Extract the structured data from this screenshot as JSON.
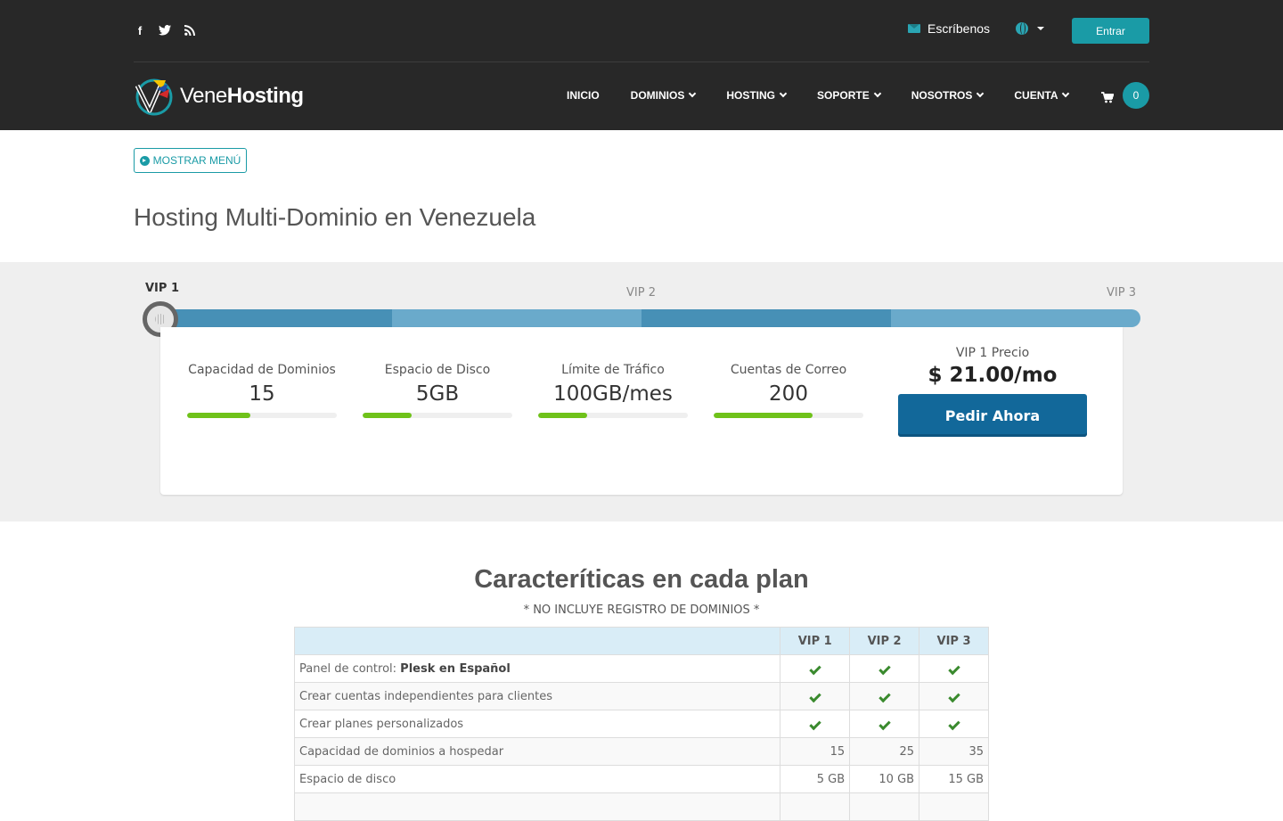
{
  "header": {
    "social": [
      {
        "icon": "facebook-icon",
        "glyph": "f"
      },
      {
        "icon": "twitter-icon",
        "glyph": "t"
      },
      {
        "icon": "rss-icon",
        "glyph": "r"
      }
    ],
    "contact_label": "Escríbenos",
    "login_label": "Entrar",
    "brand_light": "Vene",
    "brand_bold": "Hosting",
    "nav": [
      {
        "label": "INICIO",
        "dropdown": false
      },
      {
        "label": "DOMINIOS",
        "dropdown": true
      },
      {
        "label": "HOSTING",
        "dropdown": true
      },
      {
        "label": "SOPORTE",
        "dropdown": true
      },
      {
        "label": "NOSOTROS",
        "dropdown": true
      },
      {
        "label": "CUENTA",
        "dropdown": true
      }
    ],
    "cart_count": "0"
  },
  "page": {
    "menu_button": "MOSTRAR MENÚ",
    "title": "Hosting Multi-Dominio en Venezuela"
  },
  "plan_slider": {
    "tiers": [
      "VIP 1",
      "VIP 2",
      "VIP 3"
    ],
    "selected": "VIP 1",
    "colors": {
      "dark": "#4790b6",
      "light": "#6aaacb"
    }
  },
  "plan_card": {
    "stats": [
      {
        "label": "Capacidad de Dominios",
        "value": "15",
        "fill": 0.42
      },
      {
        "label": "Espacio de Disco",
        "value": "5GB",
        "fill": 0.33
      },
      {
        "label": "Límite de Tráfico",
        "value": "100GB/mes",
        "fill": 0.33
      },
      {
        "label": "Cuentas de Correo",
        "value": "200",
        "fill": 0.66
      }
    ],
    "price_label": "VIP 1 Precio",
    "price_value": "$ 21.00/mo",
    "order_button": "Pedir Ahora"
  },
  "features": {
    "title": "Caracteríticas en cada plan",
    "note": "* NO INCLUYE REGISTRO DE DOMINIOS *",
    "columns": [
      "",
      "VIP 1",
      "VIP 2",
      "VIP 3"
    ],
    "rows": [
      {
        "label": "Panel de control: ",
        "strong": "Plesk en Español",
        "type": "check",
        "values": [
          "✓",
          "✓",
          "✓"
        ]
      },
      {
        "label": "Crear cuentas independientes para clientes",
        "strong": "",
        "type": "check",
        "values": [
          "✓",
          "✓",
          "✓"
        ]
      },
      {
        "label": "Crear planes personalizados",
        "strong": "",
        "type": "check",
        "values": [
          "✓",
          "✓",
          "✓"
        ]
      },
      {
        "label": "Capacidad de dominios a hospedar",
        "strong": "",
        "type": "num",
        "values": [
          "15",
          "25",
          "35"
        ]
      },
      {
        "label": "Espacio de disco",
        "strong": "",
        "type": "num",
        "values": [
          "5 GB",
          "10 GB",
          "15 GB"
        ]
      },
      {
        "label": "",
        "strong": "",
        "type": "num",
        "values": [
          "",
          "",
          ""
        ]
      }
    ]
  },
  "colors": {
    "header_bg": "#282828",
    "accent": "#1a9ba6",
    "order_button": "#12689a",
    "progress": "#6fc21a"
  }
}
